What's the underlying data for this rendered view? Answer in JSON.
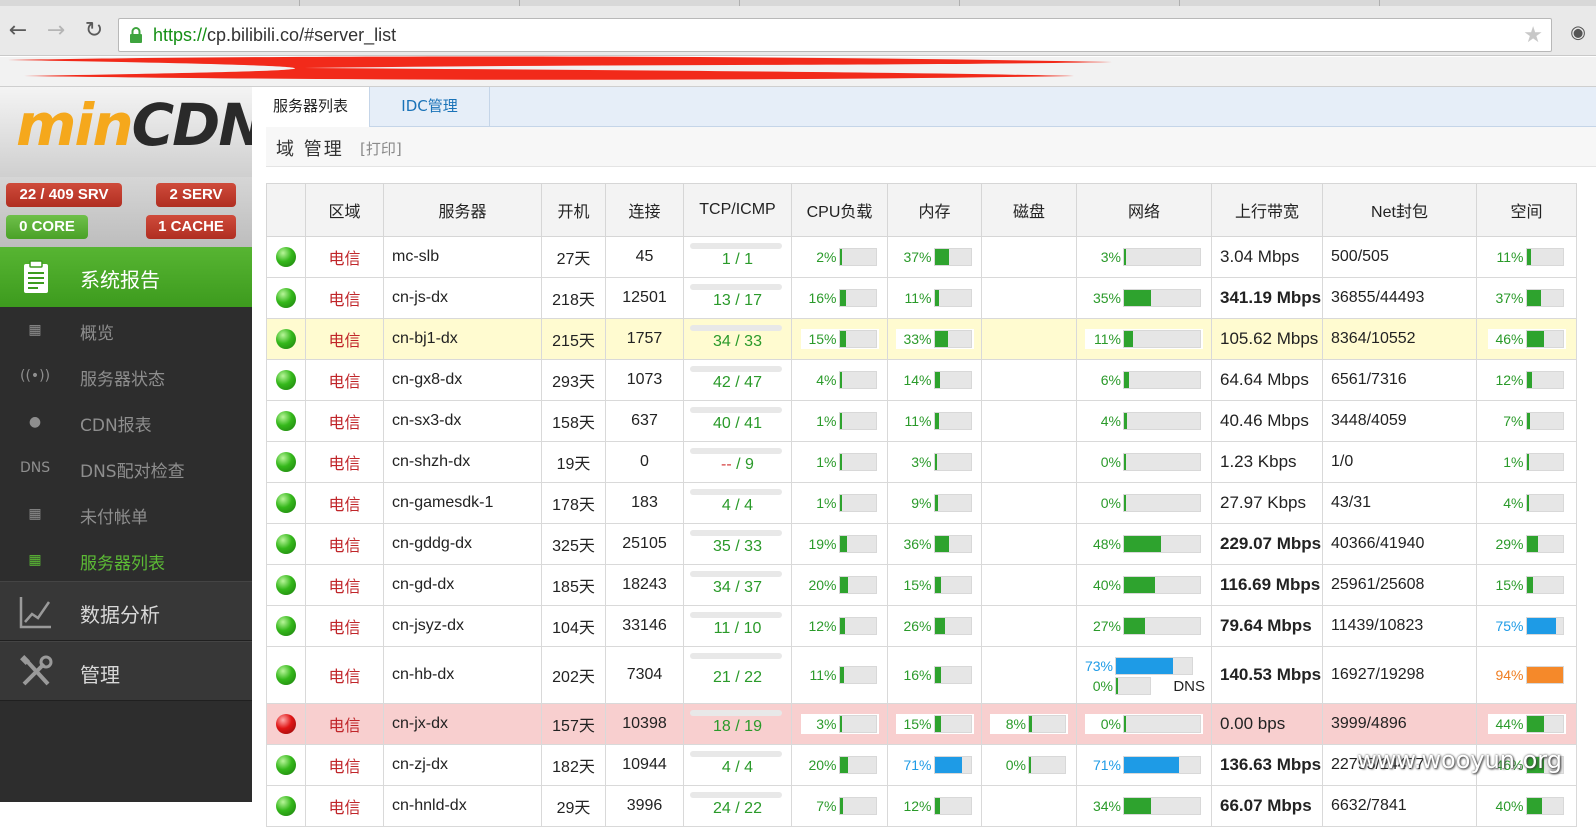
{
  "browser": {
    "url_scheme": "https://",
    "url_rest": "cp.bilibili.co/#server_list"
  },
  "sidebar": {
    "logo_part1": "min",
    "logo_part2": "CDN",
    "badges": {
      "srv": "22 / 409 SRV",
      "serv": "2 SERV",
      "core": "0 CORE",
      "cache": "1 CACHE"
    },
    "main_items": [
      {
        "label": "系统报告",
        "icon": "clipboard-icon"
      },
      {
        "label": "数据分析",
        "icon": "chart-icon"
      },
      {
        "label": "管理",
        "icon": "tools-icon"
      }
    ],
    "sub_items": [
      {
        "label": "概览",
        "icon": "device-icon"
      },
      {
        "label": "服务器状态",
        "icon": "antenna-icon"
      },
      {
        "label": "CDN报表",
        "icon": "map-pin-icon"
      },
      {
        "label": "DNS配对检查",
        "icon": "dns-icon",
        "icon_text": "DNS"
      },
      {
        "label": "未付帐单",
        "icon": "device-icon"
      },
      {
        "label": "服务器列表",
        "icon": "device-icon"
      }
    ]
  },
  "main": {
    "tabs": [
      {
        "label": "服务器列表"
      },
      {
        "label": "IDC管理"
      }
    ],
    "section_title": "域 管理",
    "print_link": "[打印]",
    "table": {
      "headers": [
        "",
        "区域",
        "服务器",
        "开机",
        "连接",
        "TCP/ICMP",
        "CPU负载",
        "内存",
        "磁盘",
        "网络",
        "上行带宽",
        "Net封包",
        "空间"
      ],
      "rows": [
        {
          "status": "up",
          "region": "电信",
          "server": "mc-slb",
          "uptime": "27天",
          "conn": "45",
          "tcp_a": "1",
          "tcp_b": "1",
          "cpu": 2,
          "mem": 37,
          "disk": "",
          "net": 3,
          "bw": "3.04 Mbps",
          "bw_alert": false,
          "packets": "500/505",
          "space": 11
        },
        {
          "status": "up",
          "region": "电信",
          "server": "cn-js-dx",
          "uptime": "218天",
          "conn": "12501",
          "tcp_a": "13",
          "tcp_b": "17",
          "cpu": 16,
          "mem": 11,
          "disk": "",
          "net": 35,
          "bw": "341.19 Mbps",
          "bw_alert": true,
          "packets": "36855/44493",
          "space": 37
        },
        {
          "status": "up",
          "region": "电信",
          "server": "cn-bj1-dx",
          "uptime": "215天",
          "conn": "1757",
          "tcp_a": "34",
          "tcp_b": "33",
          "cpu": 15,
          "mem": 33,
          "disk": "",
          "net": 11,
          "bw": "105.62 Mbps",
          "bw_alert": false,
          "packets": "8364/10552",
          "space": 46,
          "highlight": true
        },
        {
          "status": "up",
          "region": "电信",
          "server": "cn-gx8-dx",
          "uptime": "293天",
          "conn": "1073",
          "tcp_a": "42",
          "tcp_b": "47",
          "cpu": 4,
          "mem": 14,
          "disk": "",
          "net": 6,
          "bw": "64.64 Mbps",
          "bw_alert": false,
          "packets": "6561/7316",
          "space": 12
        },
        {
          "status": "up",
          "region": "电信",
          "server": "cn-sx3-dx",
          "uptime": "158天",
          "conn": "637",
          "tcp_a": "40",
          "tcp_b": "41",
          "cpu": 1,
          "mem": 11,
          "disk": "",
          "net": 4,
          "bw": "40.46 Mbps",
          "bw_alert": false,
          "packets": "3448/4059",
          "space": 7
        },
        {
          "status": "up",
          "region": "电信",
          "server": "cn-shzh-dx",
          "uptime": "19天",
          "conn": "0",
          "tcp_a": "--",
          "tcp_b": "9",
          "cpu": 1,
          "mem": 3,
          "disk": "",
          "net": 0,
          "bw": "1.23 Kbps",
          "bw_alert": false,
          "packets": "1/0",
          "space": 1
        },
        {
          "status": "up",
          "region": "电信",
          "server": "cn-gamesdk-1",
          "uptime": "178天",
          "conn": "183",
          "tcp_a": "4",
          "tcp_b": "4",
          "cpu": 1,
          "mem": 9,
          "disk": "",
          "net": 0,
          "bw": "27.97 Kbps",
          "bw_alert": false,
          "packets": "43/31",
          "space": 4
        },
        {
          "status": "up",
          "region": "电信",
          "server": "cn-gddg-dx",
          "uptime": "325天",
          "conn": "25105",
          "tcp_a": "35",
          "tcp_b": "33",
          "cpu": 19,
          "mem": 36,
          "disk": "",
          "net": 48,
          "bw": "229.07 Mbps",
          "bw_alert": true,
          "packets": "40366/41940",
          "space": 29
        },
        {
          "status": "up",
          "region": "电信",
          "server": "cn-gd-dx",
          "uptime": "185天",
          "conn": "18243",
          "tcp_a": "34",
          "tcp_b": "37",
          "cpu": 20,
          "mem": 15,
          "disk": "",
          "net": 40,
          "bw": "116.69 Mbps",
          "bw_alert": true,
          "packets": "25961/25608",
          "space": 15
        },
        {
          "status": "up",
          "region": "电信",
          "server": "cn-jsyz-dx",
          "uptime": "104天",
          "conn": "33146",
          "tcp_a": "11",
          "tcp_b": "10",
          "cpu": 12,
          "mem": 26,
          "disk": "",
          "net": 27,
          "bw": "79.64 Mbps",
          "bw_alert": true,
          "packets": "11439/10823",
          "space": 75
        },
        {
          "status": "up",
          "region": "电信",
          "server": "cn-hb-dx",
          "uptime": "202天",
          "conn": "7304",
          "tcp_a": "21",
          "tcp_b": "22",
          "cpu": 11,
          "mem": 16,
          "disk": "",
          "net": 73,
          "net2": 0,
          "dns_label": "DNS",
          "bw": "140.53 Mbps",
          "bw_alert": true,
          "packets": "16927/19298",
          "space": 94,
          "tall": true
        },
        {
          "status": "down",
          "region": "电信",
          "server": "cn-jx-dx",
          "uptime": "157天",
          "conn": "10398",
          "tcp_a": "18",
          "tcp_b": "19",
          "cpu": 3,
          "mem": 15,
          "disk": 8,
          "net": 0,
          "bw": "0.00 bps",
          "bw_alert": false,
          "packets": "3999/4896",
          "space": 44
        },
        {
          "status": "up",
          "region": "电信",
          "server": "cn-zj-dx",
          "uptime": "182天",
          "conn": "10944",
          "tcp_a": "4",
          "tcp_b": "4",
          "cpu": 20,
          "mem": 71,
          "disk": 0,
          "net": 71,
          "bw": "136.63 Mbps",
          "bw_alert": true,
          "packets": "22795/24477",
          "space": 46
        },
        {
          "status": "up",
          "region": "电信",
          "server": "cn-hnld-dx",
          "uptime": "29天",
          "conn": "3996",
          "tcp_a": "24",
          "tcp_b": "22",
          "cpu": 7,
          "mem": 12,
          "disk": "",
          "net": 34,
          "bw": "66.07 Mbps",
          "bw_alert": true,
          "packets": "6632/7841",
          "space": 40
        }
      ]
    }
  },
  "watermark": "www.wooyun.org",
  "colors": {
    "accent_green": "#3d9b1e",
    "alert_red": "#c0262a",
    "bandwidth_high": "#ef7d20",
    "bar_blue": "#1e9be6"
  }
}
